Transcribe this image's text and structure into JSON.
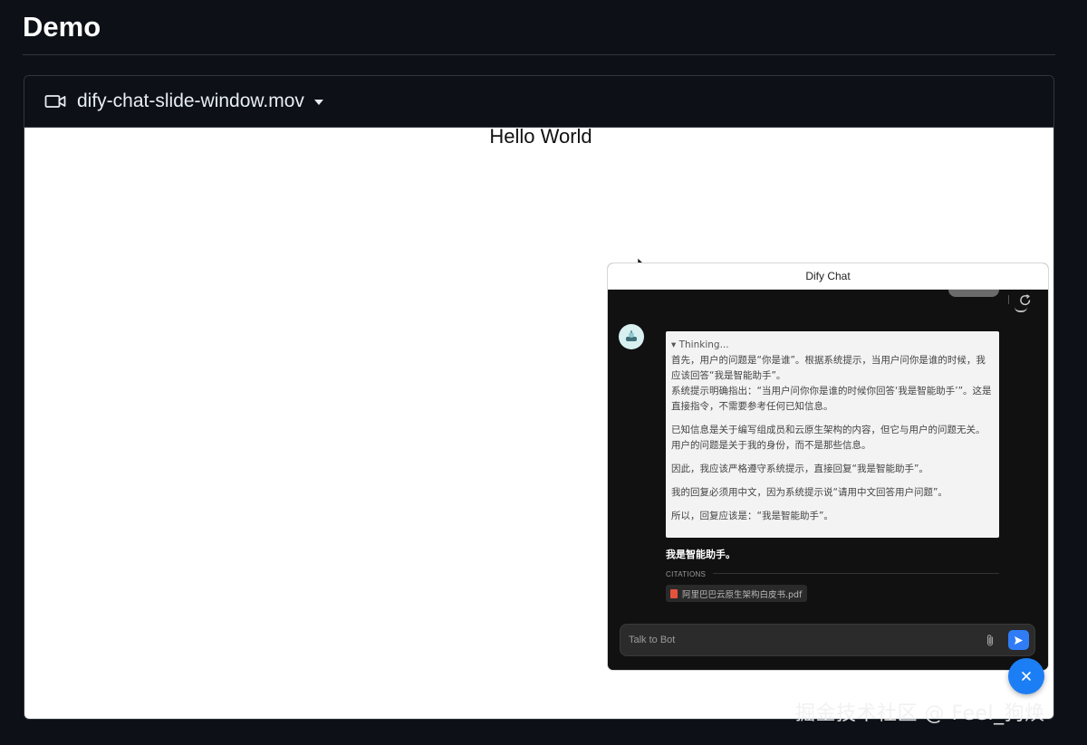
{
  "page": {
    "title": "Demo"
  },
  "video": {
    "filename": "dify-chat-slide-window.mov",
    "frame": {
      "heading": "Hello World",
      "chat_window": {
        "title": "Dify Chat",
        "thinking": {
          "label": "▾ Thinking...",
          "paragraphs": [
            "首先，用户的问题是“你是谁”。根据系统提示，当用户问你是谁的时候，我应该回答“我是智能助手”。",
            "系统提示明确指出：“当用户问你你是谁的时候你回答‘我是智能助手’”。这是直接指令，不需要参考任何已知信息。",
            "已知信息是关于编写组成员和云原生架构的内容，但它与用户的问题无关。用户的问题是关于我的身份，而不是那些信息。",
            "因此，我应该严格遵守系统提示，直接回复“我是智能助手”。",
            "我的回复必须用中文，因为系统提示说“请用中文回答用户问题”。",
            "所以，回复应该是：“我是智能助手”。"
          ]
        },
        "answer": "我是智能助手。",
        "citations_label": "CITATIONS",
        "citation_file": "阿里巴巴云原生架构白皮书.pdf",
        "input_placeholder": "Talk to Bot"
      }
    }
  },
  "colors": {
    "fab": "#1c7ef5",
    "send": "#2f7cf6",
    "pdf": "#e5533d"
  },
  "watermark": "掘金技术社区 @ Feel_狗焕"
}
